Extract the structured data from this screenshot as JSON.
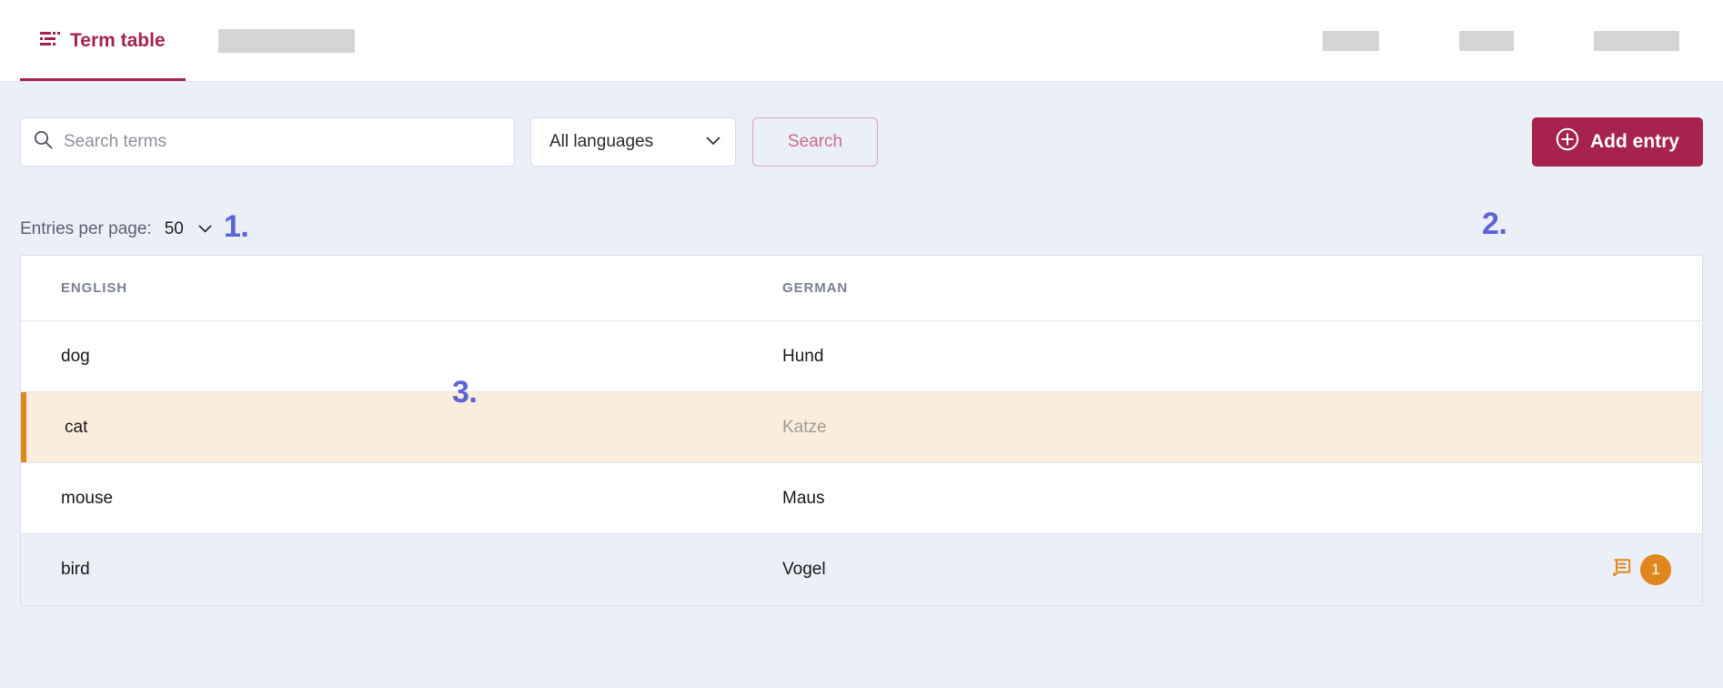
{
  "topbar": {
    "tabs": [
      {
        "label": "Term table",
        "icon": "term-table-icon",
        "active": true
      }
    ],
    "redacted_tab": "",
    "right_items": [
      "",
      "",
      ""
    ]
  },
  "toolbar": {
    "search": {
      "icon": "search-icon",
      "placeholder": "Search terms",
      "value": ""
    },
    "language_filter": {
      "selected": "All languages",
      "chevron": "chevron-down-icon"
    },
    "search_button_label": "Search",
    "add_entry_button_label": "Add entry",
    "add_entry_icon": "plus-circle-icon"
  },
  "annotations": [
    {
      "id": "1",
      "label": "1."
    },
    {
      "id": "2",
      "label": "2."
    },
    {
      "id": "3",
      "label": "3."
    }
  ],
  "pagination": {
    "entries_per_page_label": "Entries per page:",
    "entries_per_page_value": "50",
    "chevron": "chevron-down-icon"
  },
  "table": {
    "columns": [
      "ENGLISH",
      "GERMAN"
    ],
    "rows": [
      {
        "english": "dog",
        "german": "Hund",
        "state": "normal",
        "notes": null
      },
      {
        "english": "cat",
        "german": "Katze",
        "state": "selected",
        "notes": null,
        "german_muted": true
      },
      {
        "english": "mouse",
        "german": "Maus",
        "state": "normal",
        "notes": null
      },
      {
        "english": "bird",
        "german": "Vogel",
        "state": "alt",
        "notes": {
          "icon": "note-icon",
          "count": "1"
        }
      }
    ]
  },
  "colors": {
    "brand": "#a5234c",
    "page_background": "#ebeff8",
    "selected_row_background": "#fbeddc",
    "selected_row_accent": "#e0861c",
    "annotation": "#5c63d8",
    "badge": "#e0861c"
  }
}
